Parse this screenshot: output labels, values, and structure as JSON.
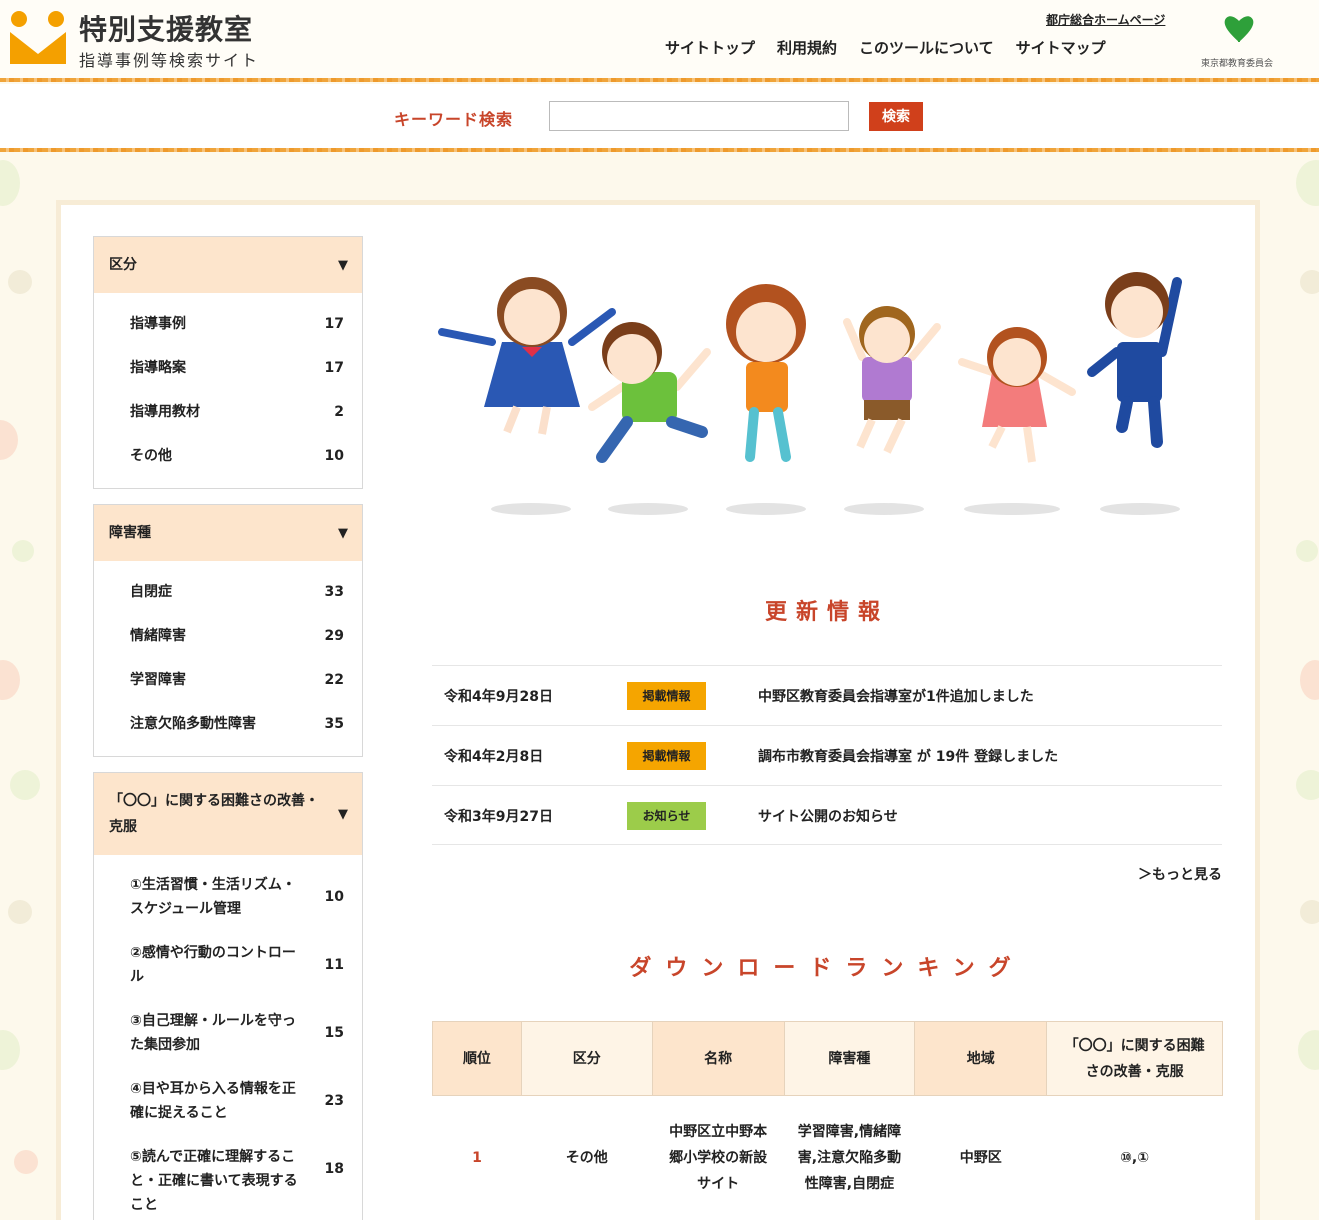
{
  "header": {
    "title": "特別支援教室",
    "subtitle": "指導事例等検索サイト",
    "nav": [
      "サイトトップ",
      "利用規約",
      "このツールについて",
      "サイトマップ"
    ],
    "tocho_link": "都庁総合ホームページ",
    "org_label": "東京都教育委員会"
  },
  "search": {
    "label": "キーワード検索",
    "placeholder": "",
    "button": "検索"
  },
  "sidebar": {
    "kubun": {
      "title": "区分",
      "items": [
        {
          "label": "指導事例",
          "count": "17"
        },
        {
          "label": "指導略案",
          "count": "17"
        },
        {
          "label": "指導用教材",
          "count": "2"
        },
        {
          "label": "その他",
          "count": "10"
        }
      ]
    },
    "shogai": {
      "title": "障害種",
      "items": [
        {
          "label": "自閉症",
          "count": "33"
        },
        {
          "label": "情緒障害",
          "count": "29"
        },
        {
          "label": "学習障害",
          "count": "22"
        },
        {
          "label": "注意欠陥多動性障害",
          "count": "35"
        }
      ]
    },
    "konnan": {
      "title": "「〇〇」に関する困難さの改善・克服",
      "items": [
        {
          "label": "①生活習慣・生活リズム・スケジュール管理",
          "count": "10"
        },
        {
          "label": "②感情や行動のコントロール",
          "count": "11"
        },
        {
          "label": "③自己理解・ルールを守った集団参加",
          "count": "15"
        },
        {
          "label": "④目や耳から入る情報を正確に捉えること",
          "count": "23"
        },
        {
          "label": "⑤読んで正確に理解すること・正確に書いて表現すること",
          "count": "18"
        }
      ]
    }
  },
  "updates": {
    "title": "更新情報",
    "items": [
      {
        "date": "令和4年9月28日",
        "badge": "掲載情報",
        "text": "中野区教育委員会指導室が1件追加しました"
      },
      {
        "date": "令和4年2月8日",
        "badge": "掲載情報",
        "text": "調布市教育委員会指導室 が 19件 登録しました"
      },
      {
        "date": "令和3年9月27日",
        "badge": "お知らせ",
        "text": "サイト公開のお知らせ"
      }
    ],
    "more": "＞もっと見る"
  },
  "ranking": {
    "title": "ダウンロードランキング",
    "headers": [
      "順位",
      "区分",
      "名称",
      "障害種",
      "地域",
      "「〇〇」に関する困難さの改善・克服"
    ],
    "rows": [
      {
        "rank": "1",
        "kubun": "その他",
        "name": "中野区立中野本郷小学校の新設サイト",
        "shogai": "学習障害,情緒障害,注意欠陥多動性障害,自閉症",
        "region": "中野区",
        "konnan": "⑩,①"
      }
    ]
  },
  "colors": {
    "accent": "#c8452a",
    "badge_keisai": "#f5a500",
    "badge_oshirase": "#9ccc4a",
    "sidebar_head": "#fde5cc"
  }
}
